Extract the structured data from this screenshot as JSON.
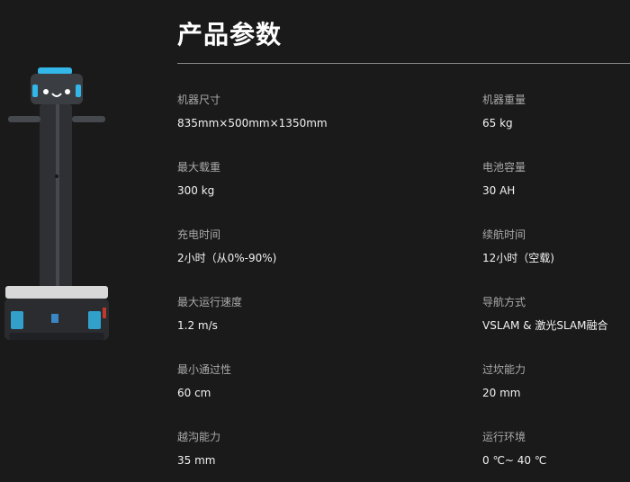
{
  "page": {
    "title": "产品参数"
  },
  "robot_image": {
    "icon": "service-robot-illustration",
    "colors": {
      "body": "#3a3d42",
      "accent": "#33b6e8",
      "face": "#ffffff"
    }
  },
  "specs": [
    {
      "label": "机器尺寸",
      "value": "835mm×500mm×1350mm"
    },
    {
      "label": "机器重量",
      "value": "65 kg"
    },
    {
      "label": "最大载重",
      "value": "300 kg"
    },
    {
      "label": "电池容量",
      "value": "30 AH"
    },
    {
      "label": "充电时间",
      "value": "2小时（从0%-90%)"
    },
    {
      "label": "续航时间",
      "value": "12小时（空载)"
    },
    {
      "label": "最大运行速度",
      "value": "1.2 m/s"
    },
    {
      "label": "导航方式",
      "value": "VSLAM & 激光SLAM融合"
    },
    {
      "label": "最小通过性",
      "value": "60 cm"
    },
    {
      "label": "过坎能力",
      "value": "20 mm"
    },
    {
      "label": "越沟能力",
      "value": "35 mm"
    },
    {
      "label": "运行环境",
      "value": "0 ℃~ 40 ℃"
    }
  ]
}
